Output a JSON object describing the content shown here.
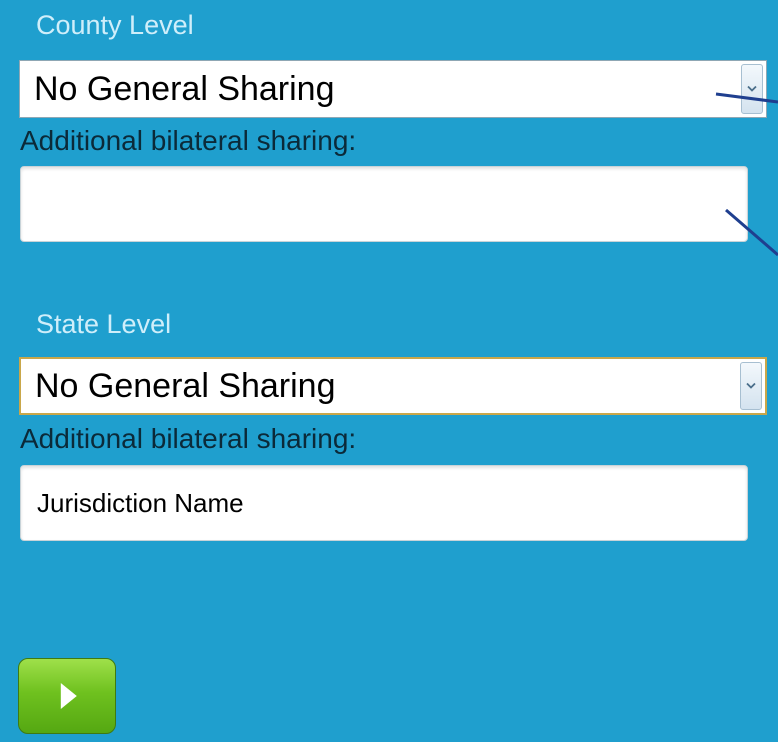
{
  "county": {
    "section_title": "County Level",
    "select_value": "No General Sharing",
    "bilateral_label": "Additional bilateral sharing:",
    "bilateral_value": ""
  },
  "state": {
    "section_title": "State Level",
    "select_value": "No General Sharing",
    "bilateral_label": "Additional bilateral sharing:",
    "bilateral_value": "Jurisdiction Name"
  },
  "icons": {
    "dropdown_arrow": "chevron-down-icon",
    "submit": "play-icon"
  },
  "colors": {
    "panel_background": "#1f9fce",
    "section_title": "#cfeefa",
    "label_text": "#0b2a39",
    "button_green": "#6fc11f",
    "focus_border": "#c9a74a",
    "callout_line": "#1f3f8f"
  }
}
